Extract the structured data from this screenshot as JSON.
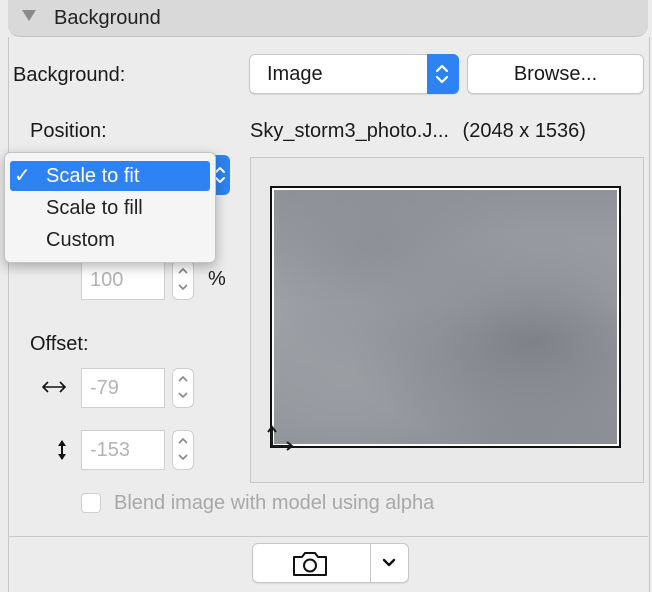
{
  "section": {
    "title": "Background"
  },
  "background": {
    "label": "Background:",
    "popup_value": "Image",
    "browse_label": "Browse..."
  },
  "position": {
    "label": "Position:",
    "menu_items": [
      {
        "label": "Scale to fit",
        "selected": true,
        "check": "✓"
      },
      {
        "label": "Scale to fill",
        "selected": false
      },
      {
        "label": "Custom",
        "selected": false
      }
    ]
  },
  "scale": {
    "value": "100",
    "unit": "%"
  },
  "offset": {
    "label": "Offset:",
    "x_value": "-79",
    "y_value": "-153",
    "x_icon": "horizontal-arrow-icon",
    "y_icon": "vertical-arrow-icon"
  },
  "image": {
    "filename": "Sky_storm3_photo.J...",
    "dimensions": "(2048 x 1536)"
  },
  "blend": {
    "label": "Blend image with model using alpha",
    "checked": false
  },
  "footer": {
    "camera_icon": "camera-icon",
    "menu_icon": "chevron-down-icon"
  },
  "colors": {
    "accent": "#2d83f3",
    "panel": "#ececec"
  }
}
